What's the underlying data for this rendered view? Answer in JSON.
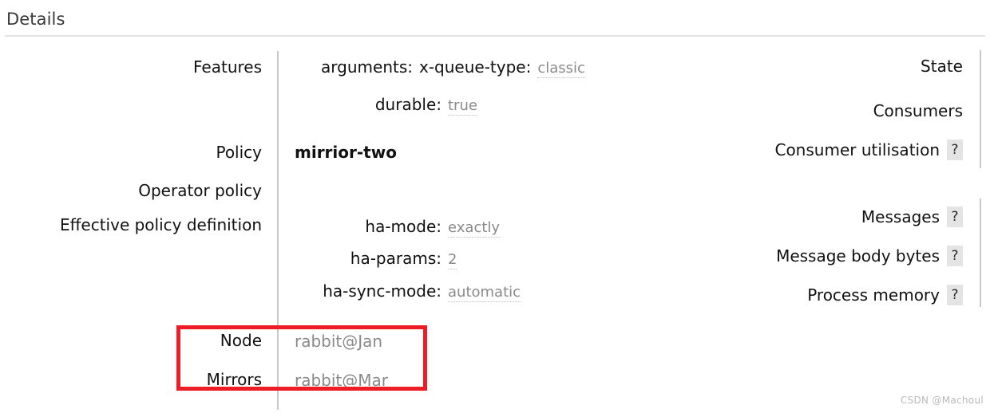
{
  "header": {
    "title": "Details"
  },
  "left_rows": [
    {
      "label": "Features"
    },
    {
      "label": "Policy"
    },
    {
      "label": "Operator policy"
    },
    {
      "label": "Effective policy definition"
    },
    {
      "label": "Node"
    },
    {
      "label": "Mirrors"
    }
  ],
  "features": {
    "label": "Features",
    "entries": [
      {
        "key": "arguments:",
        "value": "x-queue-type:  classic"
      },
      {
        "key": "durable:",
        "value": "true"
      }
    ],
    "arguments_key": "arguments:",
    "arguments_subkey": "x-queue-type:",
    "arguments_subvalue": "classic",
    "durable_key": "durable:",
    "durable_value": "true"
  },
  "policy": {
    "label": "Policy",
    "value": "mirrior-two"
  },
  "operator_policy": {
    "label": "Operator policy",
    "value": ""
  },
  "effective_policy_definition": {
    "label": "Effective policy definition",
    "entries": [
      {
        "key": "ha-mode:",
        "value": "exactly"
      },
      {
        "key": "ha-params:",
        "value": "2"
      },
      {
        "key": "ha-sync-mode:",
        "value": "automatic"
      }
    ]
  },
  "node": {
    "label": "Node",
    "value": "rabbit@Jan"
  },
  "mirrors": {
    "label": "Mirrors",
    "value": "rabbit@Mar"
  },
  "stats": {
    "rows": [
      {
        "label": "State",
        "help": ""
      },
      {
        "label": "Consumers",
        "help": ""
      },
      {
        "label": "Consumer utilisation",
        "help": "?"
      },
      {
        "label": "Messages",
        "help": "?"
      },
      {
        "label": "Message body bytes",
        "help": "?"
      },
      {
        "label": "Process memory",
        "help": "?"
      }
    ]
  },
  "annotation": {
    "color": "#ee1d25"
  },
  "watermark": {
    "text": "CSDN @Machoul"
  }
}
